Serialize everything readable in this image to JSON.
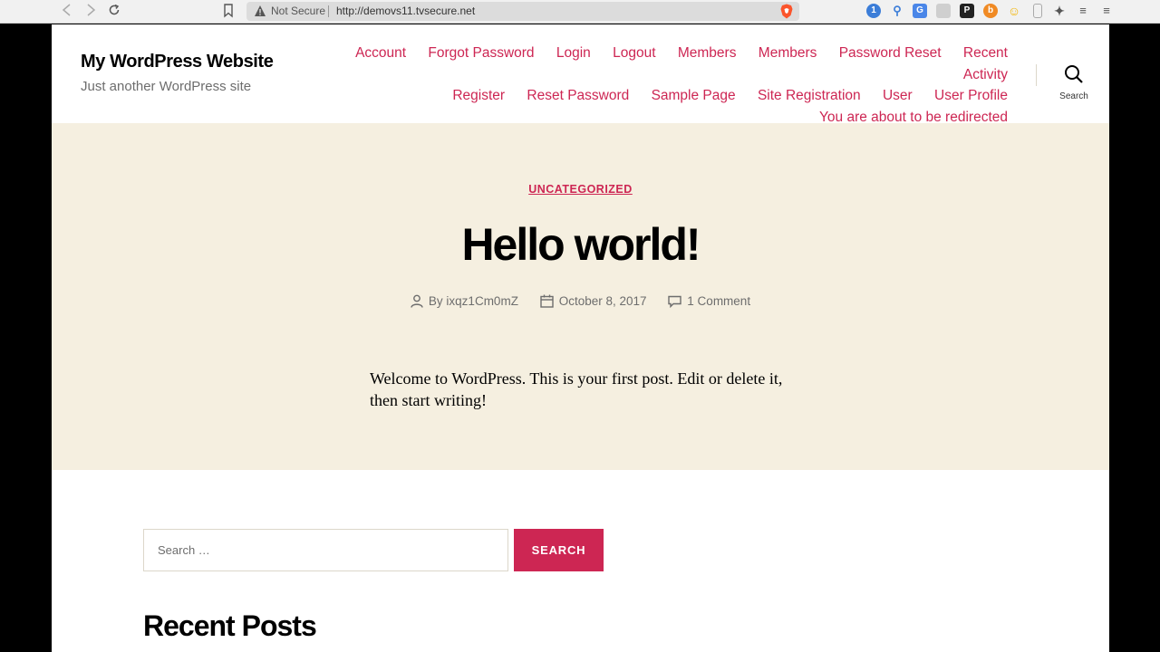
{
  "browser": {
    "back_icon": "back-arrow-icon",
    "forward_icon": "forward-arrow-icon",
    "reload_icon": "reload-icon",
    "security_label": "Not Secure",
    "url": "http://demovs11.tvsecure.net",
    "extensions": [
      "onepassword-icon",
      "key-icon",
      "translate-icon",
      "puzzle-icon",
      "p-icon",
      "b-icon",
      "emoji-icon",
      "phone-icon",
      "extensions-icon",
      "reading-list-icon"
    ]
  },
  "site": {
    "title": "My WordPress Website",
    "tagline": "Just another WordPress site"
  },
  "menu": {
    "row1": [
      "Account",
      "Forgot Password",
      "Login",
      "Logout",
      "Members",
      "Members",
      "Password Reset",
      "Recent Activity"
    ],
    "row2": [
      "Register",
      "Reset Password",
      "Sample Page",
      "Site Registration",
      "User",
      "User Profile"
    ],
    "row3": [
      "You are about to be redirected"
    ]
  },
  "search_toggle": {
    "label": "Search"
  },
  "post": {
    "category": "UNCATEGORIZED",
    "title": "Hello world!",
    "author": "By ixqz1Cm0mZ",
    "date": "October 8, 2017",
    "comments": "1 Comment",
    "excerpt": "Welcome to WordPress. This is your first post. Edit or delete it, then start writing!"
  },
  "search_widget": {
    "placeholder": "Search …",
    "button_label": "SEARCH"
  },
  "recent_posts": {
    "title": "Recent Posts"
  },
  "colors": {
    "accent": "#cd2653",
    "hero_bg": "#f5efe0"
  }
}
